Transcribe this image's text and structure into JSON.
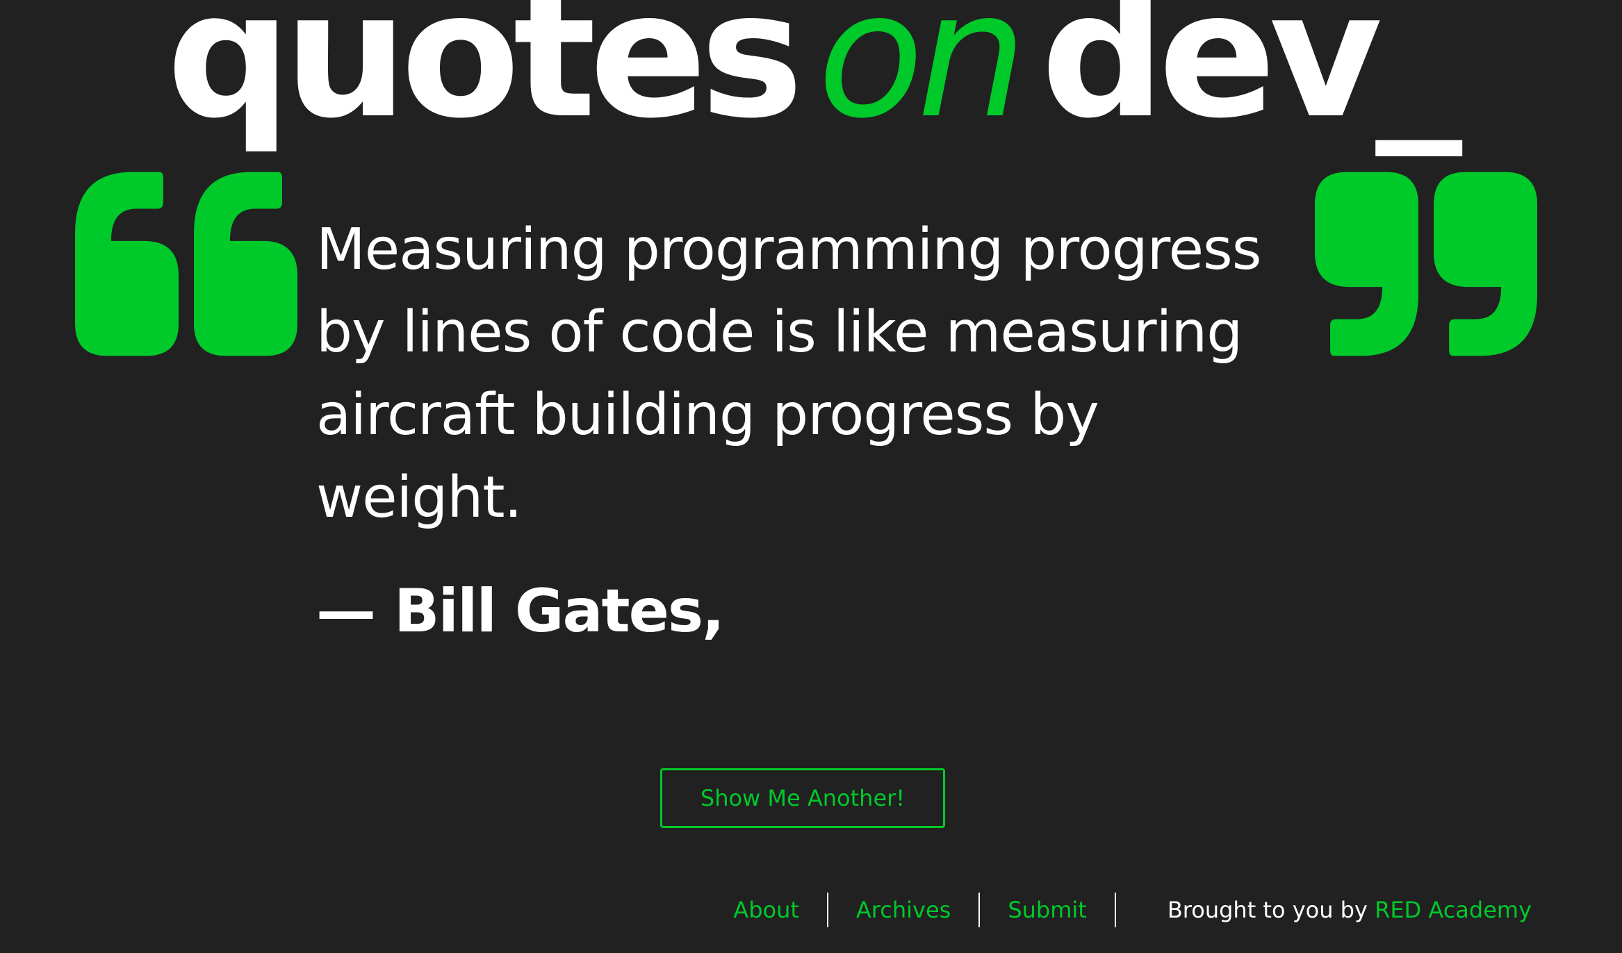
{
  "header": {
    "logo_quotes": "quotes",
    "logo_on": "on",
    "logo_dev": "dev_"
  },
  "quote": {
    "open_icon": "open-quote-icon",
    "close_icon": "close-quote-icon",
    "text": "Measuring programming progress by lines of code is like measuring aircraft building progress by weight.",
    "author": "— Bill Gates,"
  },
  "actions": {
    "show_another_label": "Show Me Another!"
  },
  "footer": {
    "nav": [
      {
        "label": "About"
      },
      {
        "label": "Archives"
      },
      {
        "label": "Submit"
      }
    ],
    "credit_prefix": "Brought to you by",
    "credit_link": "RED Academy"
  },
  "colors": {
    "background": "#212121",
    "accent": "#00c92a",
    "text": "#ffffff"
  }
}
